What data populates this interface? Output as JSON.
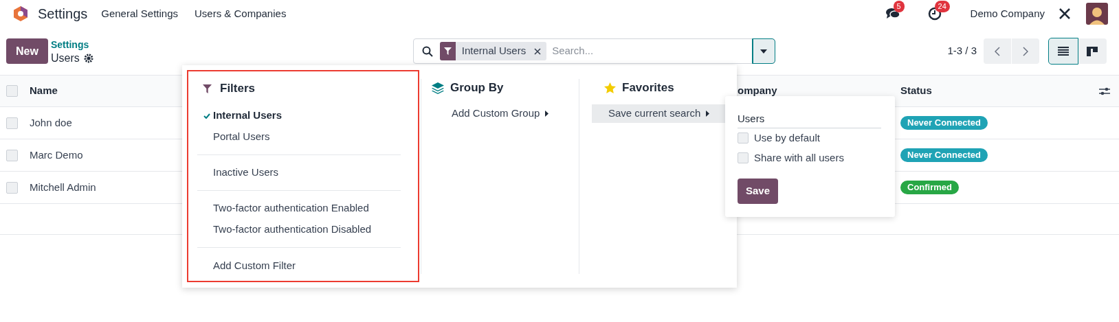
{
  "navbar": {
    "app_name": "Settings",
    "menu": [
      "General Settings",
      "Users & Companies"
    ],
    "messages_badge": "5",
    "activities_badge": "24",
    "company": "Demo Company"
  },
  "control_panel": {
    "new_button": "New",
    "breadcrumb": "Settings",
    "title": "Users",
    "pager": "1-3 / 3",
    "views": [
      {
        "kind": "list",
        "selected": true
      },
      {
        "kind": "kanban",
        "selected": false
      }
    ]
  },
  "search": {
    "facet": "Internal Users",
    "placeholder": "Search..."
  },
  "table": {
    "select_all_checked": false,
    "columns": [
      "Name",
      "ompany",
      "Status"
    ],
    "rows": [
      {
        "checked": false,
        "name": "John doe",
        "status": "Never Connected",
        "color": "#1fa3b5"
      },
      {
        "checked": false,
        "name": "Marc Demo",
        "status": "Never Connected",
        "color": "#1fa3b5"
      },
      {
        "checked": false,
        "name": "Mitchell Admin",
        "status": "Confirmed",
        "color": "#28a745"
      }
    ]
  },
  "filters_dropdown": {
    "filters_title": "Filters",
    "filter_groups": [
      [
        {
          "label": "Internal Users",
          "selected": true
        },
        {
          "label": "Portal Users",
          "selected": false
        }
      ],
      [
        {
          "label": "Inactive Users",
          "selected": false
        }
      ],
      [
        {
          "label": "Two-factor authentication Enabled",
          "selected": false
        },
        {
          "label": "Two-factor authentication Disabled",
          "selected": false
        }
      ]
    ],
    "add_custom_filter": "Add Custom Filter",
    "group_by_title": "Group By",
    "add_custom_group": "Add Custom Group",
    "favorites_title": "Favorites",
    "save_current_search": "Save current search"
  },
  "save_popover": {
    "name": "Users",
    "options": [
      {
        "label": "Use by default",
        "checked": false
      },
      {
        "label": "Share with all users",
        "checked": false
      }
    ],
    "button": "Save"
  }
}
